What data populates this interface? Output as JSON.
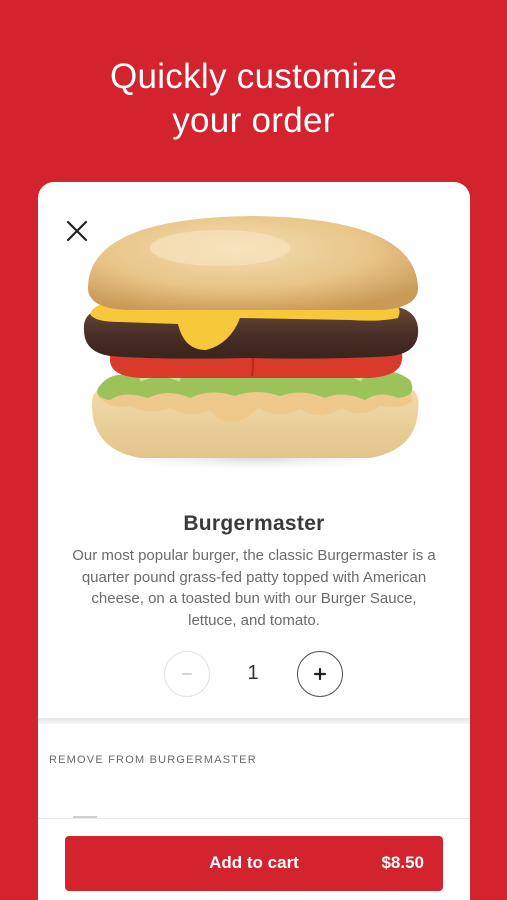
{
  "headline": {
    "line1": "Quickly customize",
    "line2": "your order"
  },
  "product": {
    "image_icon": "burger-image",
    "name": "Burgermaster",
    "description": "Our most popular burger, the classic Burgermaster is a quarter pound grass-fed patty topped with American cheese, on a toasted bun with our Burger Sauce, lettuce, and tomato."
  },
  "stepper": {
    "minus_label": "−",
    "quantity": "1",
    "plus_label": "+"
  },
  "customize": {
    "section_label": "REMOVE FROM BURGERMASTER"
  },
  "cart": {
    "button_label": "Add to cart",
    "price": "$8.50"
  },
  "colors": {
    "brand_red": "#D2232E",
    "card_bg": "#FFFFFF",
    "text_dark": "#3A3A3A",
    "text_muted": "#6B6B6B"
  }
}
